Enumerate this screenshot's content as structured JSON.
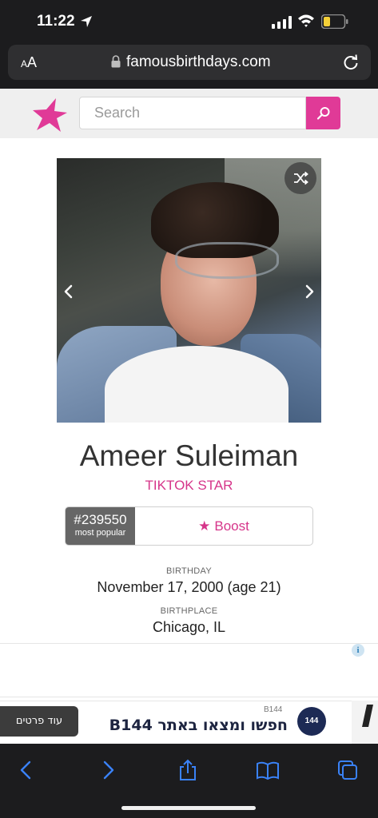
{
  "status_bar": {
    "time": "11:22"
  },
  "browser": {
    "text_size_label": "AA",
    "url": "famousbirthdays.com"
  },
  "site": {
    "search_placeholder": "Search",
    "brand_color": "#e03a97"
  },
  "profile": {
    "name": "Ameer Suleiman",
    "occupation": "TIKTOK STAR",
    "rank": "#239550",
    "rank_label": "most popular",
    "boost_label": "Boost",
    "birthday_label": "BIRTHDAY",
    "birthday_value": "November 17, 2000 (age 21)",
    "birthplace_label": "BIRTHPLACE",
    "birthplace_value": "Chicago, IL"
  },
  "ad": {
    "cta_label": "עוד פרטים",
    "brand_small": "B144",
    "headline": "חפשו ומצאו באתר B144",
    "logo_text": "144"
  }
}
